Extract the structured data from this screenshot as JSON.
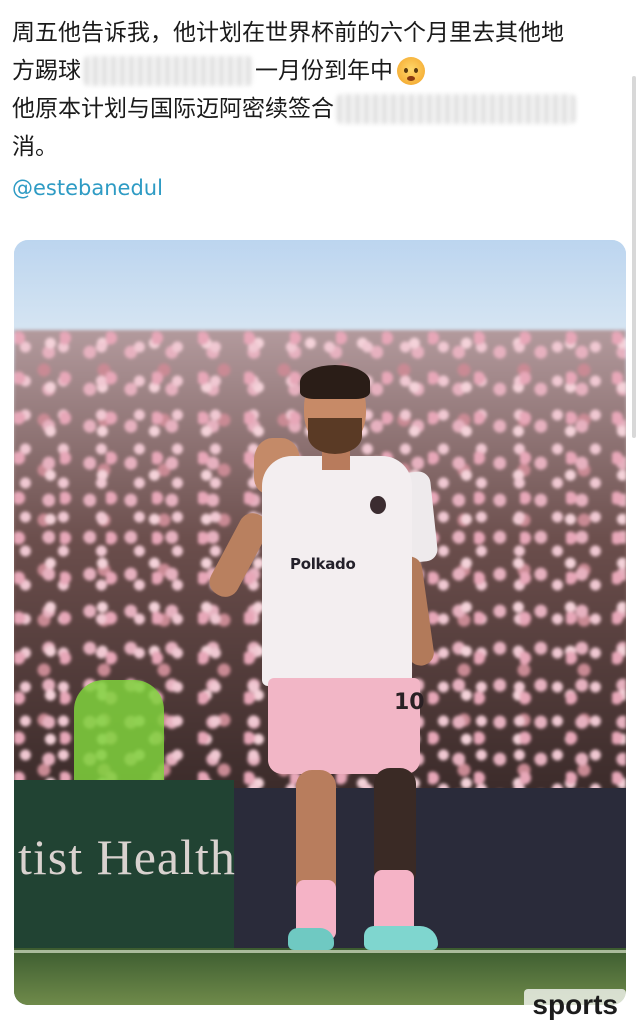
{
  "post": {
    "line1": "周五他告诉我，他计划在世界杯前的六个月里去其他地",
    "line2_start": "方踢球",
    "line2_end": "一月份到年中",
    "line3_start": "他原本计划与国际迈阿密续签合",
    "line4": "消。",
    "mention": "@estebanedul"
  },
  "photo": {
    "banner_text": "tist Health",
    "sponsor": "Polkado",
    "shorts_number": "10",
    "emoji_icon": "exploding-head-emoji"
  },
  "watermark": "sports"
}
